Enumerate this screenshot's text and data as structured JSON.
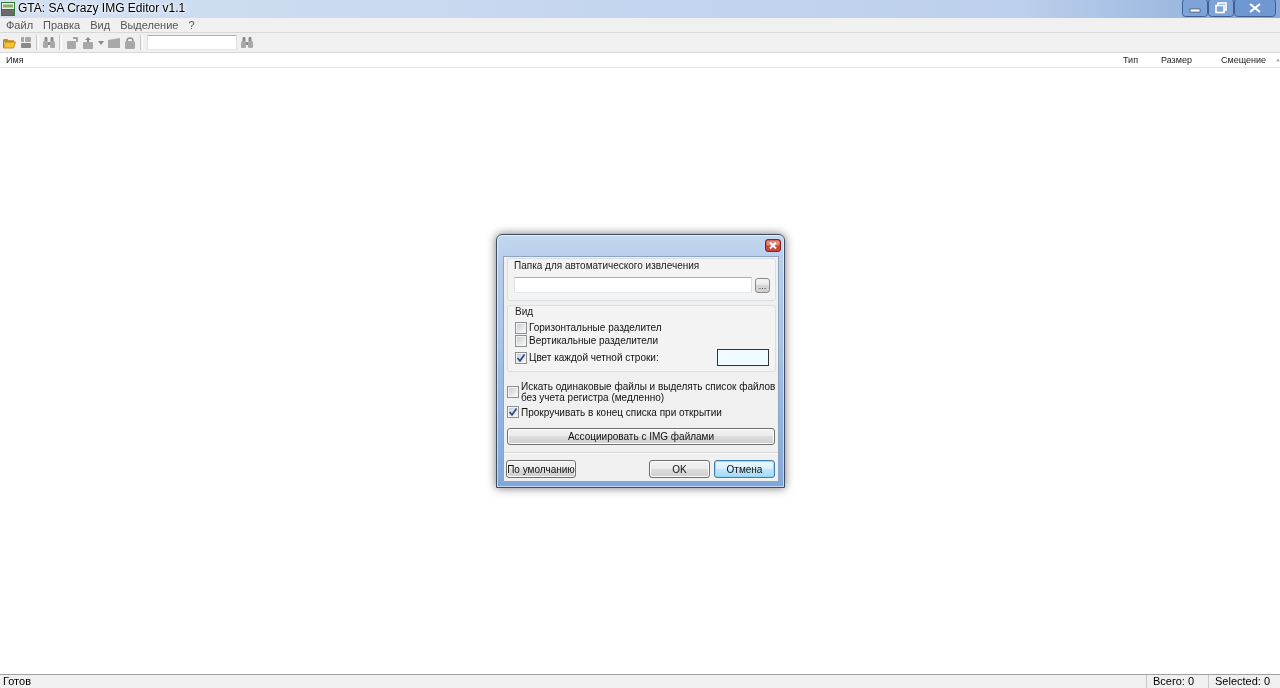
{
  "window": {
    "title": "GTA: SA Crazy IMG Editor v1.1"
  },
  "menu": [
    {
      "label": "Файл"
    },
    {
      "label": "Правка"
    },
    {
      "label": "Вид"
    },
    {
      "label": "Выделение"
    },
    {
      "label": "?"
    }
  ],
  "toolbar": [
    {
      "kind": "folder",
      "disabled": false
    },
    {
      "kind": "tiles",
      "disabled": true
    },
    {
      "kind": "separator"
    },
    {
      "kind": "binoculars",
      "disabled": true
    },
    {
      "kind": "separator"
    },
    {
      "kind": "box_in",
      "disabled": true
    },
    {
      "kind": "box_up",
      "disabled": true
    },
    {
      "kind": "caret",
      "disabled": true
    },
    {
      "kind": "box",
      "disabled": true
    },
    {
      "kind": "box_round",
      "disabled": true
    },
    {
      "kind": "separator"
    },
    {
      "kind": "search"
    },
    {
      "kind": "binoculars",
      "disabled": true
    }
  ],
  "list": {
    "columns": [
      {
        "label": "Имя",
        "sorted": false
      },
      {
        "label": "Тип",
        "sorted": false
      },
      {
        "label": "Размер",
        "sorted": false
      },
      {
        "label": "Смещение",
        "sorted": true
      }
    ]
  },
  "dialog": {
    "folder_group": {
      "label": "Папка для автоматического извлечения",
      "browse_label": "..."
    },
    "view_group": {
      "label": "Вид",
      "options": [
        {
          "kind": "check",
          "label": "Горизонтальные разделител",
          "checked": false
        },
        {
          "kind": "check",
          "label": "Вертикальные разделители",
          "checked": false
        },
        {
          "kind": "color",
          "label": "Цвет каждой четной строки:",
          "checked": true,
          "color": "#f0fcff"
        }
      ]
    },
    "options": [
      {
        "label": "Искать одинаковые файлы и выделять список файлов без учета регистра (медленно)",
        "checked": false
      },
      {
        "label": "Прокручивать в конец списка при открытии",
        "checked": true
      }
    ],
    "associate_button": {
      "label": "Ассоциировать с IMG файлами"
    },
    "buttons": [
      {
        "label": "По умолчанию",
        "focused": false
      },
      {
        "label": "OK",
        "focused": false
      },
      {
        "label": "Отмена",
        "focused": true
      }
    ]
  },
  "status_bar": {
    "text": "Готов",
    "total": "Всего: 0",
    "selected": "Selected: 0"
  }
}
